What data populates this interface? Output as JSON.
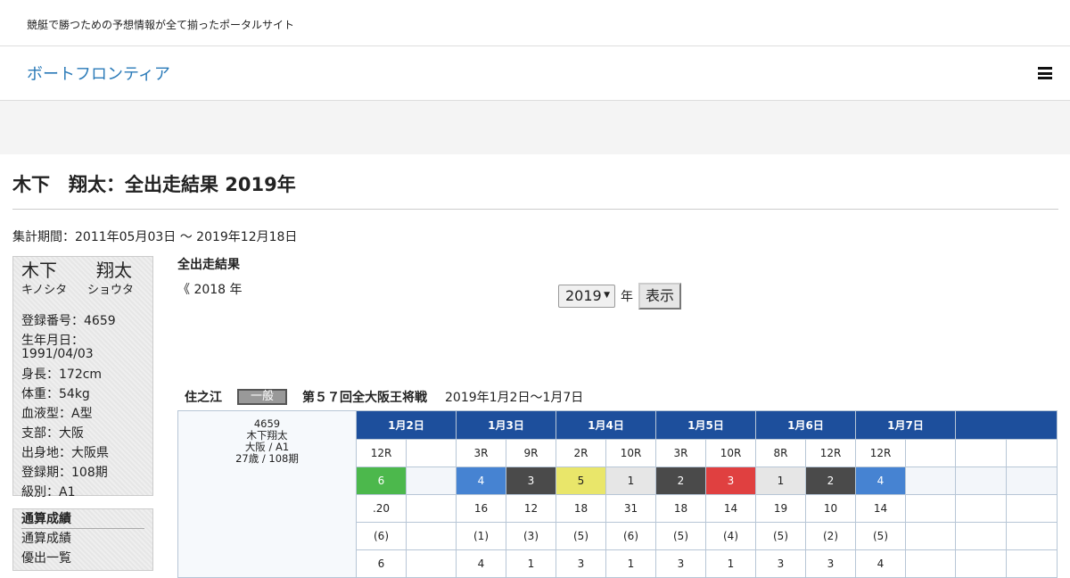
{
  "header": {
    "tagline": "競艇で勝つための予想情報が全て揃ったポータルサイト",
    "site_title": "ボートフロンティア",
    "menu_icon": "hamburger-menu-icon"
  },
  "page": {
    "title": "木下　翔太：全出走結果 2019年",
    "period": "集計期間：2011年05月03日 ～ 2019年12月18日"
  },
  "profile": {
    "last_name": "木下",
    "first_name": "翔太",
    "last_kana": "キノシタ",
    "first_kana": "ショウタ",
    "reg_no": "登録番号：4659",
    "birth_label": "生年月日：",
    "birth_date": "1991/04/03",
    "height": "身長：172cm",
    "weight": "体重：54kg",
    "blood": "血液型：A型",
    "branch": "支部：大阪",
    "hometown": "出身地：大阪県",
    "term": "登録期：108期",
    "class": "級別：A1"
  },
  "stats_box": {
    "heading": "通算成績",
    "items": [
      "通算成績",
      "優出一覧"
    ]
  },
  "results": {
    "heading": "全出走結果",
    "prev_year": "《  2018 年",
    "year_value": "2019",
    "year_suffix": "年",
    "show_button": "表示"
  },
  "race": {
    "venue": "住之江",
    "grade": "一般",
    "name": "第５７回全大阪王将戦",
    "dates": "2019年1月2日～1月7日",
    "racer_lines": [
      "4659",
      "木下翔太",
      "大阪 / A1",
      "27歳 / 108期"
    ],
    "days": [
      "1月2日",
      "1月3日",
      "1月4日",
      "1月5日",
      "1月6日",
      "1月7日",
      ""
    ],
    "race_nos": [
      "12R",
      "",
      "3R",
      "9R",
      "2R",
      "10R",
      "3R",
      "10R",
      "8R",
      "12R",
      "12R",
      "",
      "",
      ""
    ],
    "boats": [
      "6",
      "",
      "4",
      "3",
      "5",
      "1",
      "2",
      "3",
      "1",
      "2",
      "4",
      "",
      "",
      ""
    ],
    "boat_colors": [
      "c-green",
      "c-empty",
      "c-blue",
      "c-dark",
      "c-yellow",
      "c-light",
      "c-dark",
      "c-red",
      "c-light",
      "c-dark",
      "c-blue",
      "c-empty",
      "c-empty",
      "c-empty"
    ],
    "st": [
      ".20",
      "",
      "16",
      "12",
      "18",
      "31",
      "18",
      "14",
      "19",
      "10",
      "14",
      "",
      "",
      ""
    ],
    "st_rank": [
      "(6)",
      "",
      "(1)",
      "(3)",
      "(5)",
      "(6)",
      "(5)",
      "(4)",
      "(5)",
      "(2)",
      "(5)",
      "",
      "",
      ""
    ],
    "finish": [
      "6",
      "",
      "4",
      "1",
      "3",
      "1",
      "3",
      "1",
      "3",
      "3",
      "4",
      "",
      "",
      ""
    ]
  }
}
